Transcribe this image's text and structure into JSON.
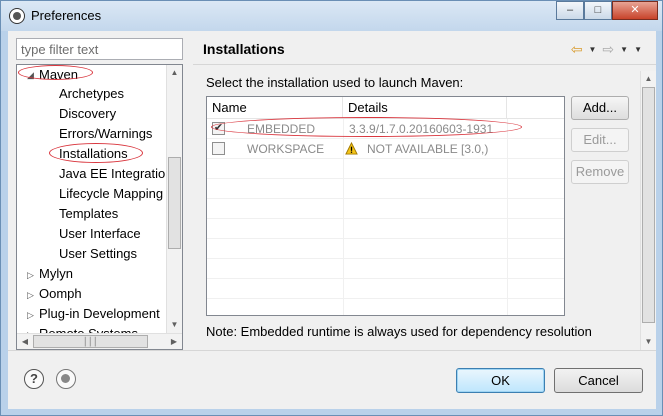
{
  "window": {
    "title": "Preferences"
  },
  "filter": {
    "placeholder": "type filter text"
  },
  "tree": {
    "maven": "Maven",
    "maven_children": [
      "Archetypes",
      "Discovery",
      "Errors/Warnings",
      "Installations",
      "Java EE Integration",
      "Lifecycle Mapping",
      "Templates",
      "User Interface",
      "User Settings"
    ],
    "siblings": [
      "Mylyn",
      "Oomph",
      "Plug-in Development",
      "Remote Systems"
    ]
  },
  "panel": {
    "title": "Installations",
    "description": "Select the installation used to launch Maven:",
    "columns": {
      "name": "Name",
      "details": "Details"
    },
    "rows": [
      {
        "name": "EMBEDDED",
        "details": "3.3.9/1.7.0.20160603-1931",
        "checked": true
      },
      {
        "name": "WORKSPACE",
        "details": "NOT AVAILABLE [3.0,)",
        "checked": false,
        "warning": true
      }
    ],
    "buttons": {
      "add": "Add...",
      "edit": "Edit...",
      "remove": "Remove"
    },
    "note": "Note: Embedded runtime is always used for dependency resolution"
  },
  "footer": {
    "ok": "OK",
    "cancel": "Cancel"
  },
  "colors": {
    "annotation_red": "#d9363e",
    "window_frame": "#b9d1ea",
    "ok_border": "#3c7fb1"
  }
}
